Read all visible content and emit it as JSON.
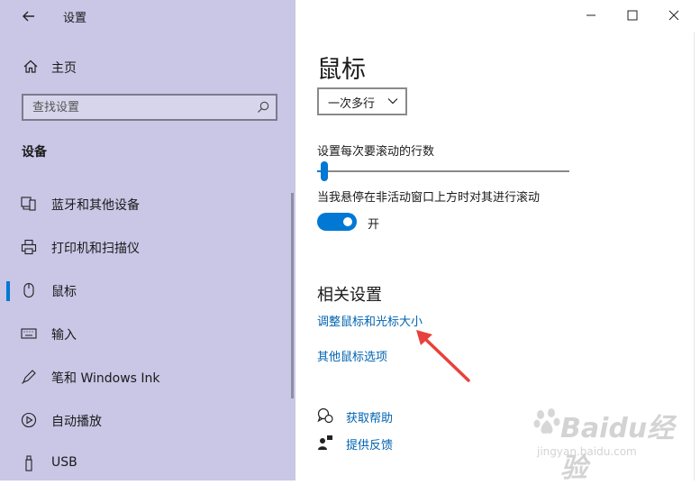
{
  "window": {
    "title": "设置",
    "controls": {
      "minimize": "minimize-icon",
      "maximize": "maximize-icon",
      "close": "close-icon"
    }
  },
  "sidebar": {
    "home_label": "主页",
    "search_placeholder": "查找设置",
    "section_title": "设备",
    "items": [
      {
        "label": "蓝牙和其他设备",
        "icon": "bluetooth-devices-icon",
        "active": false
      },
      {
        "label": "打印机和扫描仪",
        "icon": "printer-icon",
        "active": false
      },
      {
        "label": "鼠标",
        "icon": "mouse-icon",
        "active": true
      },
      {
        "label": "输入",
        "icon": "keyboard-icon",
        "active": false
      },
      {
        "label": "笔和 Windows Ink",
        "icon": "pen-icon",
        "active": false
      },
      {
        "label": "自动播放",
        "icon": "autoplay-icon",
        "active": false
      },
      {
        "label": "USB",
        "icon": "usb-icon",
        "active": false
      }
    ]
  },
  "main": {
    "page_title": "鼠标",
    "scroll_mode_value": "一次多行",
    "lines_label": "设置每次要滚动的行数",
    "lines_slider_fraction": 0.03,
    "inactive_scroll_label": "当我悬停在非活动窗口上方时对其进行滚动",
    "inactive_scroll_state": "开",
    "related_title": "相关设置",
    "related_links": [
      "调整鼠标和光标大小",
      "其他鼠标选项"
    ],
    "help": {
      "get_help": "获取帮助",
      "feedback": "提供反馈"
    }
  },
  "watermark": {
    "text": "Baidu经验",
    "sub": "jingyan.baidu.com"
  },
  "colors": {
    "sidebar_bg": "#c9c6e6",
    "accent": "#0078d4",
    "link": "#0063b1",
    "arrow": "#e8413b"
  }
}
